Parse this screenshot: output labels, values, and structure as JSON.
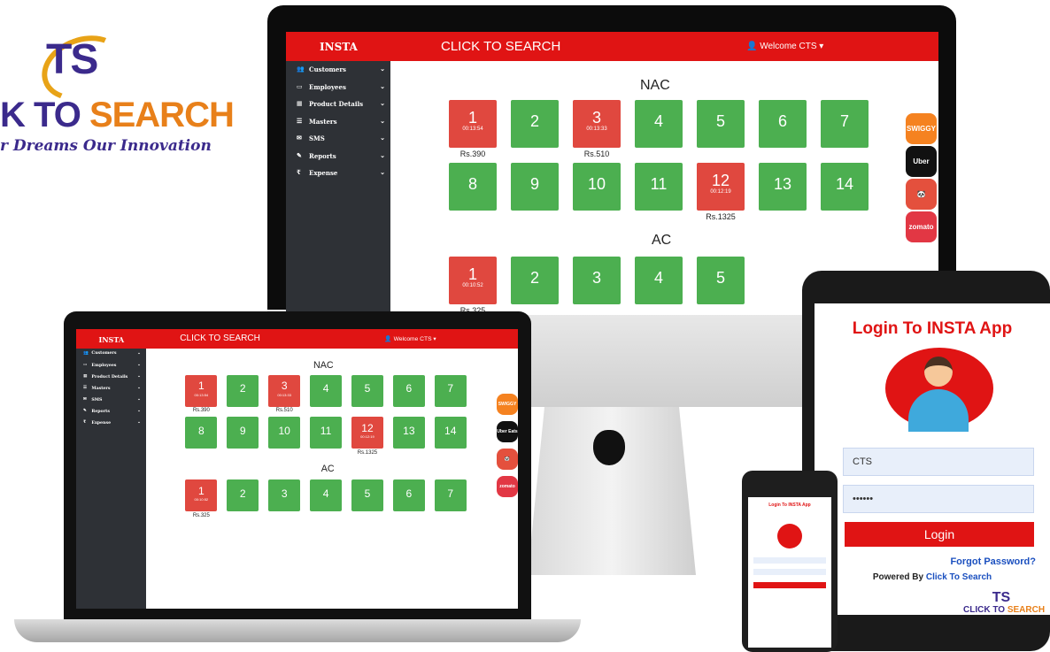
{
  "logo": {
    "mark": "TS",
    "word_a": "K TO ",
    "word_b": "SEARCH",
    "tagline": "r Dreams Our Innovation"
  },
  "app": {
    "brand": "INSTA",
    "center_title": "CLICK TO SEARCH",
    "welcome": "Welcome CTS",
    "sidebar": [
      {
        "label": "Customers",
        "icon": "users-icon",
        "glyph": "👥"
      },
      {
        "label": "Employees",
        "icon": "monitor-icon",
        "glyph": "▭"
      },
      {
        "label": "Product Details",
        "icon": "table-icon",
        "glyph": "▦"
      },
      {
        "label": "Masters",
        "icon": "list-icon",
        "glyph": "☰"
      },
      {
        "label": "SMS",
        "icon": "envelope-icon",
        "glyph": "✉"
      },
      {
        "label": "Reports",
        "icon": "pencil-icon",
        "glyph": "✎"
      },
      {
        "label": "Expense",
        "icon": "rupee-icon",
        "glyph": "₹"
      }
    ],
    "sections": {
      "nac": "NAC",
      "ac": "AC"
    },
    "nac_tables": [
      {
        "n": "1",
        "status": "occupied",
        "time": "00:13:54",
        "amount": "Rs.390"
      },
      {
        "n": "2",
        "status": "free"
      },
      {
        "n": "3",
        "status": "occupied",
        "time": "00:13:33",
        "amount": "Rs.510"
      },
      {
        "n": "4",
        "status": "free"
      },
      {
        "n": "5",
        "status": "free"
      },
      {
        "n": "6",
        "status": "free"
      },
      {
        "n": "7",
        "status": "free"
      },
      {
        "n": "8",
        "status": "free"
      },
      {
        "n": "9",
        "status": "free"
      },
      {
        "n": "10",
        "status": "free"
      },
      {
        "n": "11",
        "status": "free"
      },
      {
        "n": "12",
        "status": "occupied",
        "time": "00:12:19",
        "amount": "Rs.1325"
      },
      {
        "n": "13",
        "status": "free"
      },
      {
        "n": "14",
        "status": "free"
      }
    ],
    "ac_tables_monitor": [
      {
        "n": "1",
        "status": "occupied",
        "time": "00:10:52",
        "amount": "Rs.325"
      },
      {
        "n": "2",
        "status": "free"
      },
      {
        "n": "3",
        "status": "free"
      },
      {
        "n": "4",
        "status": "free"
      },
      {
        "n": "5",
        "status": "free"
      }
    ],
    "ac_tables_laptop": [
      {
        "n": "1",
        "status": "occupied",
        "time": "00:10:52",
        "amount": "Rs.325"
      },
      {
        "n": "2",
        "status": "free"
      },
      {
        "n": "3",
        "status": "free"
      },
      {
        "n": "4",
        "status": "free"
      },
      {
        "n": "5",
        "status": "free"
      },
      {
        "n": "6",
        "status": "free"
      },
      {
        "n": "7",
        "status": "free"
      }
    ],
    "delivery": [
      {
        "name": "swiggy",
        "label": "SWIGGY",
        "color": "#f58220"
      },
      {
        "name": "uber-eats",
        "label": "Uber Eats",
        "color": "#111111"
      },
      {
        "name": "foodpanda",
        "label": "🐼",
        "color": "#e4503d"
      },
      {
        "name": "zomato",
        "label": "zomato",
        "color": "#e23744"
      }
    ],
    "colors": {
      "header": "#e01414",
      "sidebar": "#2e3136",
      "free": "#4caf50",
      "occupied": "#e0483f"
    }
  },
  "login": {
    "title": "Login To INSTA App",
    "username": "CTS",
    "password": "••••••",
    "button": "Login",
    "forgot": "Forgot Password?",
    "powered_prefix": "Powered By ",
    "powered_link": "Click To Search",
    "mini_logo_mark": "TS",
    "mini_logo_a": "CLICK TO ",
    "mini_logo_b": "SEARCH"
  }
}
